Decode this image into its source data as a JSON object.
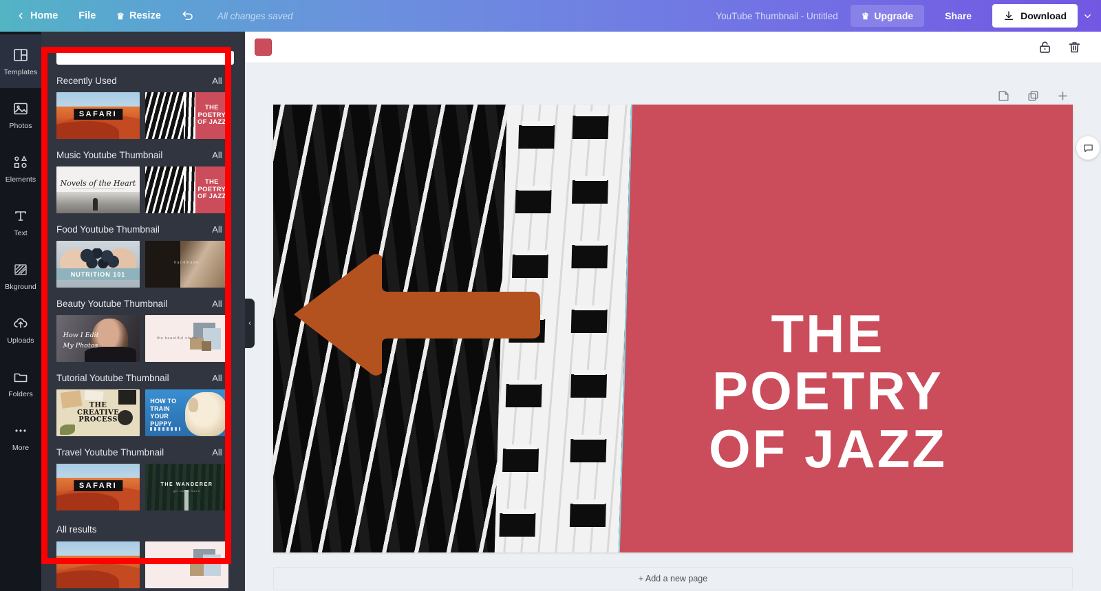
{
  "topbar": {
    "back_icon": "chevron-left-icon",
    "home": "Home",
    "file": "File",
    "resize": "Resize",
    "resize_icon": "crown-icon",
    "undo_icon": "undo-arrow-icon",
    "saved_status": "All changes saved",
    "doc_title": "YouTube Thumbnail - Untitled",
    "upgrade": "Upgrade",
    "upgrade_icon": "crown-icon",
    "share": "Share",
    "download": "Download",
    "download_icon": "download-arrow-icon",
    "caret_icon": "chevron-down-icon",
    "gradient_start": "#53b4c4",
    "gradient_end": "#7257e2"
  },
  "rail": {
    "items": [
      {
        "label": "Templates",
        "icon": "templates-grid-icon",
        "active": true
      },
      {
        "label": "Photos",
        "icon": "photo-image-icon",
        "active": false
      },
      {
        "label": "Elements",
        "icon": "shapes-icon",
        "active": false
      },
      {
        "label": "Text",
        "icon": "text-t-icon",
        "active": false
      },
      {
        "label": "Bkground",
        "icon": "background-hatch-icon",
        "active": false
      },
      {
        "label": "Uploads",
        "icon": "upload-cloud-icon",
        "active": false
      },
      {
        "label": "Folders",
        "icon": "folder-icon",
        "active": false
      },
      {
        "label": "More",
        "icon": "ellipsis-icon",
        "active": false
      }
    ]
  },
  "panel": {
    "search_placeholder": "",
    "collapse_icon": "chevron-left-icon",
    "all_label": "All",
    "all_chevron": "chevron-right-icon",
    "footer": "All results",
    "sections": [
      {
        "title": "Recently Used",
        "thumbs": [
          {
            "name": "safari-template",
            "caption": "SAFARI",
            "art": "safari"
          },
          {
            "name": "poetry-of-jazz-template",
            "caption": "THE\nPOETRY\nOF JAZZ",
            "art": "jazz"
          }
        ]
      },
      {
        "title": "Music Youtube Thumbnail",
        "thumbs": [
          {
            "name": "novels-of-the-heart-template",
            "caption": "Novels of the Heart",
            "art": "novels"
          },
          {
            "name": "poetry-of-jazz-template",
            "caption": "THE\nPOETRY\nOF JAZZ",
            "art": "jazz"
          }
        ]
      },
      {
        "title": "Food Youtube Thumbnail",
        "thumbs": [
          {
            "name": "nutrition-101-template",
            "caption": "NUTRITION 101",
            "art": "nutrition"
          },
          {
            "name": "baking-template",
            "caption": "handmade",
            "art": "bread"
          }
        ]
      },
      {
        "title": "Beauty Youtube Thumbnail",
        "thumbs": [
          {
            "name": "how-i-edit-my-photos-template",
            "caption": "How I Edit|My Photos",
            "art": "edit"
          },
          {
            "name": "beauty-collage-template",
            "caption": "the beautiful studio",
            "art": "collage"
          }
        ]
      },
      {
        "title": "Tutorial Youtube Thumbnail",
        "thumbs": [
          {
            "name": "creative-process-template",
            "caption": "THE\nCREATIVE\nPROCESS",
            "art": "creative"
          },
          {
            "name": "how-to-train-your-puppy-template",
            "caption": "HOW TO\nTRAIN\nYOUR\nPUPPY",
            "art": "puppy"
          }
        ]
      },
      {
        "title": "Travel Youtube Thumbnail",
        "thumbs": [
          {
            "name": "safari-template",
            "caption": "SAFARI",
            "art": "safari"
          },
          {
            "name": "the-wanderer-template",
            "caption": "THE WANDERER",
            "art": "wanderer"
          }
        ]
      }
    ]
  },
  "canvas_toolbar": {
    "swatch_color": "#cb4c5a",
    "lock_icon": "unlock-icon",
    "delete_icon": "trash-icon"
  },
  "page_tools": {
    "notes_icon": "note-icon",
    "duplicate_icon": "copy-icon",
    "add_icon": "plus-icon"
  },
  "design": {
    "background_color": "#cb4c5a",
    "selection_color": "#7fd3de",
    "photo_name": "building-facade-photo",
    "arrow_color": "#b3521f",
    "headline": [
      "THE",
      "POETRY",
      "OF JAZZ"
    ],
    "headline_color": "#ffffff"
  },
  "comment_button": {
    "icon": "comment-bubble-icon"
  },
  "footer": {
    "add_page": "+ Add a new page"
  },
  "annotation": {
    "box_color": "#ff0000",
    "arrow_color": "#b3521f"
  }
}
